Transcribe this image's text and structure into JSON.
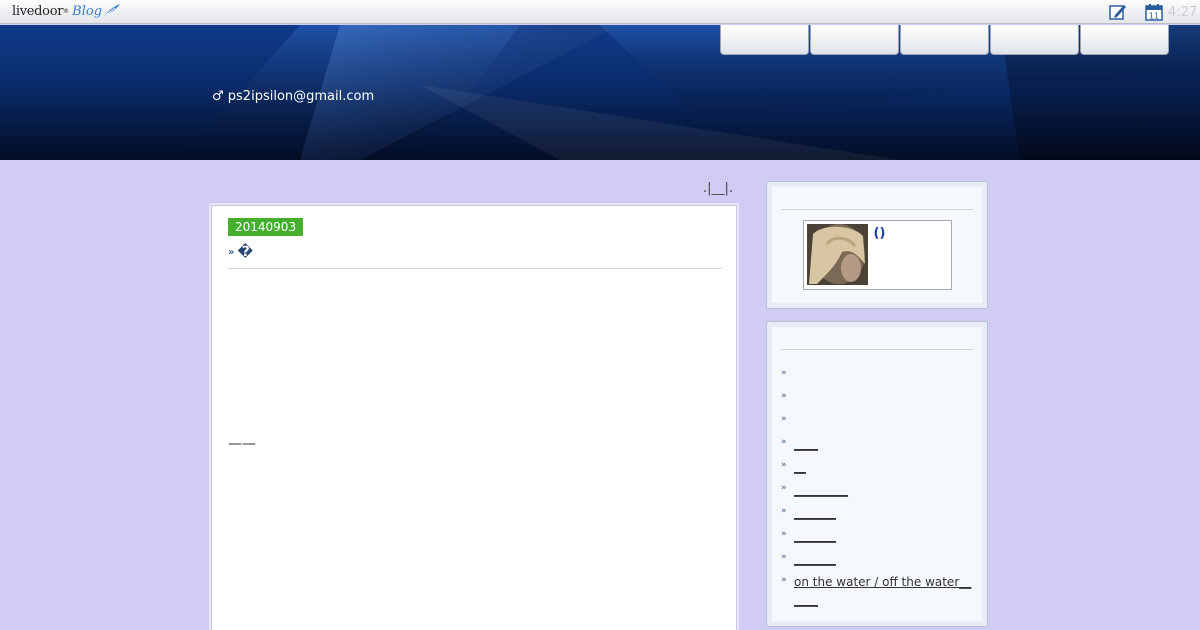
{
  "topbar": {
    "logo_text": "livedoor",
    "logo_sub": "Blog",
    "icons": [
      "edit-icon",
      "calendar-icon"
    ],
    "calendar_day": "11",
    "clock_text": "4:27"
  },
  "header": {
    "nav_items": [
      "",
      "",
      "",
      "",
      ""
    ],
    "email": "♂ ps2ipsilon@gmail.com"
  },
  "main": {
    "top_links": ".|__|.",
    "entry": {
      "date": "20140903",
      "title": "�",
      "lines": [
        "",
        "",
        "",
        "",
        "",
        "",
        "——",
        "",
        "",
        "",
        "",
        "",
        "",
        ""
      ]
    }
  },
  "sidebar": {
    "profile": {
      "name": "()"
    },
    "list": [
      {
        "label": ""
      },
      {
        "label": ""
      },
      {
        "label": ""
      },
      {
        "label": "____"
      },
      {
        "label": "__"
      },
      {
        "label": "_________"
      },
      {
        "label": "_______"
      },
      {
        "label": "_______"
      },
      {
        "label": "_______"
      },
      {
        "label": " on the water / off the water______"
      }
    ]
  }
}
